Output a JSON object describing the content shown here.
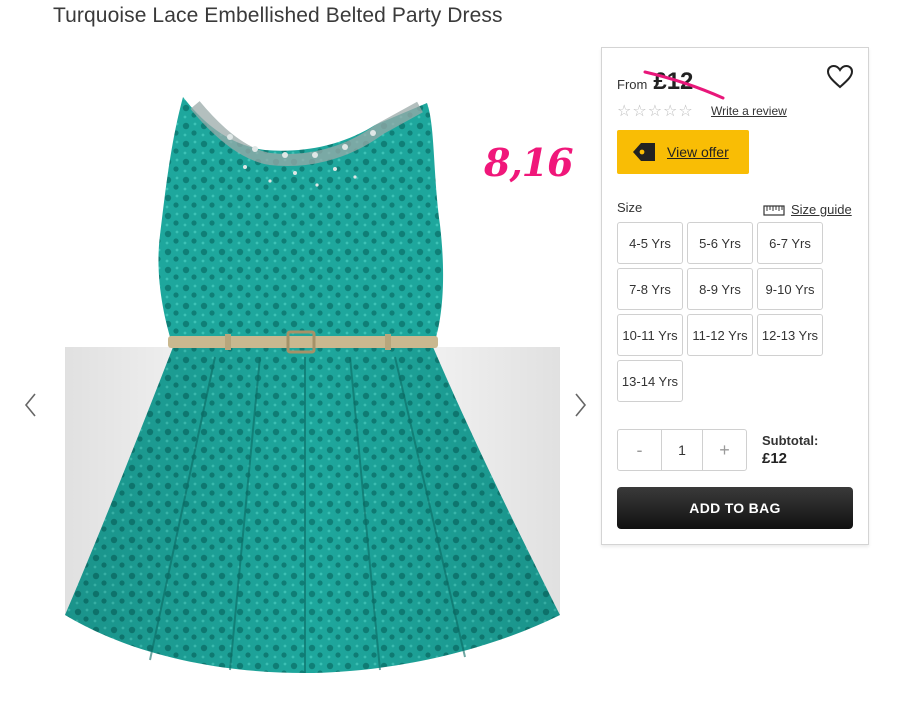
{
  "product": {
    "title": "Turquoise Lace Embellished Belted Party Dress",
    "annotation": "8,16"
  },
  "gallery": {
    "prev_icon": "chevron-left-icon",
    "next_icon": "chevron-right-icon",
    "dress_color": "#1aa39a"
  },
  "panel": {
    "from_label": "From",
    "price": "£12",
    "strike_color": "#e8177a",
    "rating_stars": 0,
    "review_link": "Write a review",
    "offer_label": "View offer",
    "offer_color": "#f9bd05",
    "size_label": "Size",
    "size_guide_label": "Size guide",
    "sizes": [
      "4-5 Yrs",
      "5-6 Yrs",
      "6-7 Yrs",
      "7-8 Yrs",
      "8-9 Yrs",
      "9-10 Yrs",
      "10-11 Yrs",
      "11-12 Yrs",
      "12-13 Yrs",
      "13-14 Yrs"
    ],
    "quantity": {
      "minus": "-",
      "value": "1",
      "plus": "+"
    },
    "subtotal_label": "Subtotal:",
    "subtotal_value": "£12",
    "add_to_bag_label": "ADD TO BAG"
  }
}
